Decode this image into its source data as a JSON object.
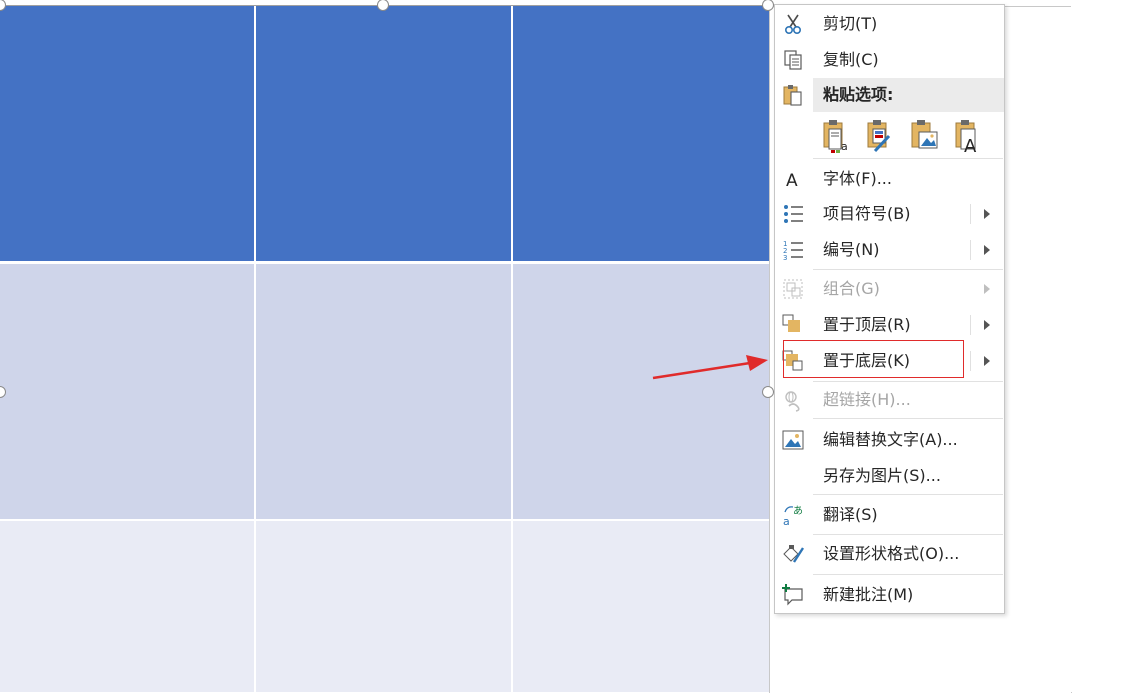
{
  "menu": {
    "cut": "剪切(T)",
    "copy": "复制(C)",
    "paste_options": "粘贴选项:",
    "paste_buttons": [
      "keep-text-only-paste-icon",
      "use-destination-theme-paste-icon",
      "picture-paste-icon",
      "keep-text-paste-icon"
    ],
    "font": "字体(F)...",
    "bullets": "项目符号(B)",
    "numbering": "编号(N)",
    "group": "组合(G)",
    "bring_to_front": "置于顶层(R)",
    "send_to_back": "置于底层(K)",
    "hyperlink": "超链接(H)...",
    "edit_alt_text": "编辑替换文字(A)...",
    "save_as_picture": "另存为图片(S)...",
    "translate": "翻译(S)",
    "format_shape": "设置形状格式(O)...",
    "new_comment": "新建批注(M)"
  },
  "colors": {
    "table_header": "#4472c4",
    "table_row_1": "#cfd5ea",
    "table_row_2": "#e9ebf5",
    "annotation": "#e02b2b"
  }
}
